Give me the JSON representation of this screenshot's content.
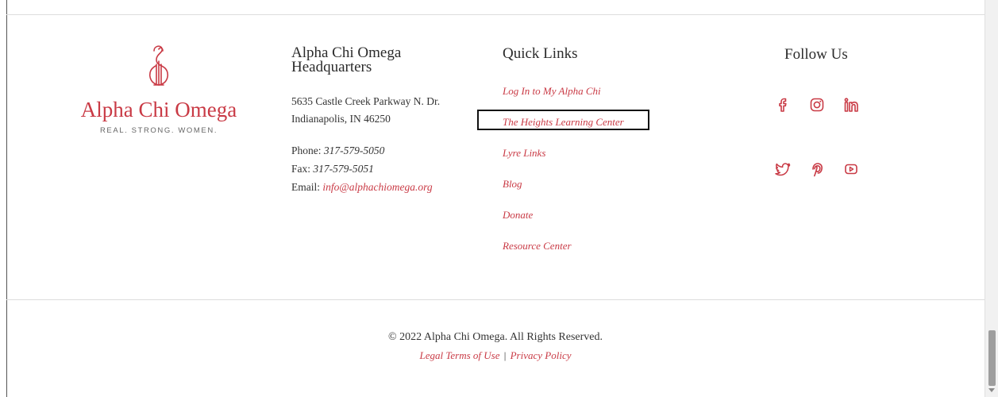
{
  "brand": {
    "name": "Alpha Chi Omega",
    "tagline": "REAL. STRONG. WOMEN.",
    "accent_color": "#c93a45"
  },
  "headquarters": {
    "title": "Alpha Chi Omega Headquarters",
    "address_line1": "5635 Castle Creek Parkway N. Dr.",
    "address_line2": "Indianapolis, IN 46250",
    "phone_label": "Phone:",
    "phone": "317-579-5050",
    "fax_label": "Fax:",
    "fax": "317-579-5051",
    "email_label": "Email:",
    "email": "info@alphachiomega.org"
  },
  "quick_links": {
    "title": "Quick Links",
    "items": [
      {
        "label": "Log In to My Alpha Chi"
      },
      {
        "label": "The Heights Learning Center"
      },
      {
        "label": "Lyre Links"
      },
      {
        "label": "Blog"
      },
      {
        "label": "Donate"
      },
      {
        "label": "Resource Center"
      }
    ]
  },
  "follow": {
    "title": "Follow Us",
    "icons": [
      "facebook-icon",
      "instagram-icon",
      "linkedin-icon",
      "twitter-icon",
      "pinterest-icon",
      "youtube-icon"
    ]
  },
  "footer": {
    "copyright": "© 2022 Alpha Chi Omega. All Rights Reserved.",
    "legal_label": "Legal Terms of Use",
    "separator": "|",
    "privacy_label": "Privacy Policy"
  }
}
